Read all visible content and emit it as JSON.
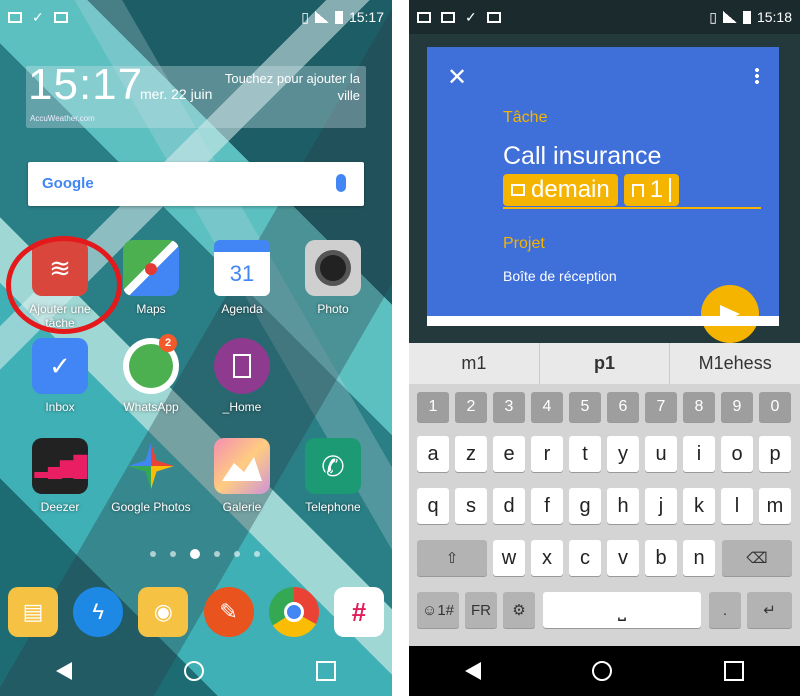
{
  "left": {
    "status_time": "15:17",
    "clock": {
      "time": "15:17",
      "date": "mer. 22 juin",
      "city": "Touchez pour ajouter la ville",
      "source": "AccuWeather.com"
    },
    "search_logo": "Google",
    "apps": [
      {
        "label": "Ajouter une tâche"
      },
      {
        "label": "Maps"
      },
      {
        "label": "Agenda",
        "glyph": "31"
      },
      {
        "label": "Photo"
      },
      {
        "label": "Inbox"
      },
      {
        "label": "WhatsApp",
        "badge": "2"
      },
      {
        "label": "_Home"
      },
      {
        "label": "Deezer"
      },
      {
        "label": "Google Photos"
      },
      {
        "label": "Galerie"
      },
      {
        "label": "Telephone"
      }
    ]
  },
  "right": {
    "status_time": "15:18",
    "task": {
      "section_label": "Tâche",
      "title": "Call insurance",
      "date_chip": "demain",
      "priority_chip": "1",
      "project_label": "Projet",
      "project_value": "Boîte de réception"
    },
    "suggestions": [
      "m1",
      "p1",
      "M1ehess"
    ],
    "keyboard": {
      "numbers": [
        "1",
        "2",
        "3",
        "4",
        "5",
        "6",
        "7",
        "8",
        "9",
        "0"
      ],
      "row1": [
        "a",
        "z",
        "e",
        "r",
        "t",
        "y",
        "u",
        "i",
        "o",
        "p"
      ],
      "row2": [
        "q",
        "s",
        "d",
        "f",
        "g",
        "h",
        "j",
        "k",
        "l",
        "m"
      ],
      "row3": [
        "w",
        "x",
        "c",
        "v",
        "b",
        "n"
      ],
      "sym": "☺1#",
      "lang": "FR",
      "enter": "↵"
    }
  }
}
